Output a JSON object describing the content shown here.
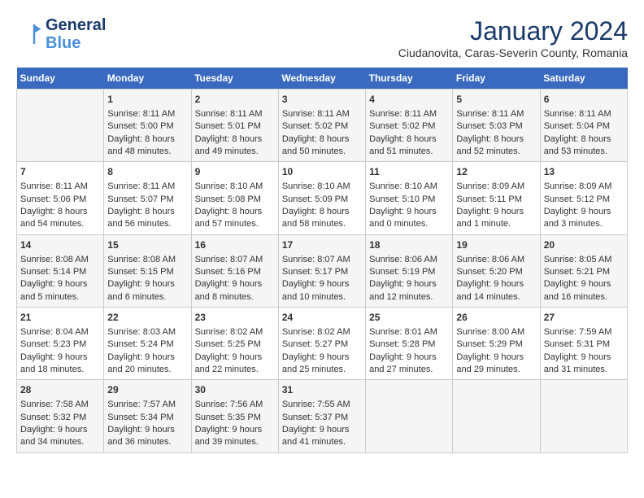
{
  "header": {
    "logo_line1": "General",
    "logo_line2": "Blue",
    "month": "January 2024",
    "location": "Ciudanovita, Caras-Severin County, Romania"
  },
  "days_of_week": [
    "Sunday",
    "Monday",
    "Tuesday",
    "Wednesday",
    "Thursday",
    "Friday",
    "Saturday"
  ],
  "weeks": [
    [
      {
        "day": "",
        "content": ""
      },
      {
        "day": "1",
        "content": "Sunrise: 8:11 AM\nSunset: 5:00 PM\nDaylight: 8 hours\nand 48 minutes."
      },
      {
        "day": "2",
        "content": "Sunrise: 8:11 AM\nSunset: 5:01 PM\nDaylight: 8 hours\nand 49 minutes."
      },
      {
        "day": "3",
        "content": "Sunrise: 8:11 AM\nSunset: 5:02 PM\nDaylight: 8 hours\nand 50 minutes."
      },
      {
        "day": "4",
        "content": "Sunrise: 8:11 AM\nSunset: 5:02 PM\nDaylight: 8 hours\nand 51 minutes."
      },
      {
        "day": "5",
        "content": "Sunrise: 8:11 AM\nSunset: 5:03 PM\nDaylight: 8 hours\nand 52 minutes."
      },
      {
        "day": "6",
        "content": "Sunrise: 8:11 AM\nSunset: 5:04 PM\nDaylight: 8 hours\nand 53 minutes."
      }
    ],
    [
      {
        "day": "7",
        "content": "Sunrise: 8:11 AM\nSunset: 5:06 PM\nDaylight: 8 hours\nand 54 minutes."
      },
      {
        "day": "8",
        "content": "Sunrise: 8:11 AM\nSunset: 5:07 PM\nDaylight: 8 hours\nand 56 minutes."
      },
      {
        "day": "9",
        "content": "Sunrise: 8:10 AM\nSunset: 5:08 PM\nDaylight: 8 hours\nand 57 minutes."
      },
      {
        "day": "10",
        "content": "Sunrise: 8:10 AM\nSunset: 5:09 PM\nDaylight: 8 hours\nand 58 minutes."
      },
      {
        "day": "11",
        "content": "Sunrise: 8:10 AM\nSunset: 5:10 PM\nDaylight: 9 hours\nand 0 minutes."
      },
      {
        "day": "12",
        "content": "Sunrise: 8:09 AM\nSunset: 5:11 PM\nDaylight: 9 hours\nand 1 minute."
      },
      {
        "day": "13",
        "content": "Sunrise: 8:09 AM\nSunset: 5:12 PM\nDaylight: 9 hours\nand 3 minutes."
      }
    ],
    [
      {
        "day": "14",
        "content": "Sunrise: 8:08 AM\nSunset: 5:14 PM\nDaylight: 9 hours\nand 5 minutes."
      },
      {
        "day": "15",
        "content": "Sunrise: 8:08 AM\nSunset: 5:15 PM\nDaylight: 9 hours\nand 6 minutes."
      },
      {
        "day": "16",
        "content": "Sunrise: 8:07 AM\nSunset: 5:16 PM\nDaylight: 9 hours\nand 8 minutes."
      },
      {
        "day": "17",
        "content": "Sunrise: 8:07 AM\nSunset: 5:17 PM\nDaylight: 9 hours\nand 10 minutes."
      },
      {
        "day": "18",
        "content": "Sunrise: 8:06 AM\nSunset: 5:19 PM\nDaylight: 9 hours\nand 12 minutes."
      },
      {
        "day": "19",
        "content": "Sunrise: 8:06 AM\nSunset: 5:20 PM\nDaylight: 9 hours\nand 14 minutes."
      },
      {
        "day": "20",
        "content": "Sunrise: 8:05 AM\nSunset: 5:21 PM\nDaylight: 9 hours\nand 16 minutes."
      }
    ],
    [
      {
        "day": "21",
        "content": "Sunrise: 8:04 AM\nSunset: 5:23 PM\nDaylight: 9 hours\nand 18 minutes."
      },
      {
        "day": "22",
        "content": "Sunrise: 8:03 AM\nSunset: 5:24 PM\nDaylight: 9 hours\nand 20 minutes."
      },
      {
        "day": "23",
        "content": "Sunrise: 8:02 AM\nSunset: 5:25 PM\nDaylight: 9 hours\nand 22 minutes."
      },
      {
        "day": "24",
        "content": "Sunrise: 8:02 AM\nSunset: 5:27 PM\nDaylight: 9 hours\nand 25 minutes."
      },
      {
        "day": "25",
        "content": "Sunrise: 8:01 AM\nSunset: 5:28 PM\nDaylight: 9 hours\nand 27 minutes."
      },
      {
        "day": "26",
        "content": "Sunrise: 8:00 AM\nSunset: 5:29 PM\nDaylight: 9 hours\nand 29 minutes."
      },
      {
        "day": "27",
        "content": "Sunrise: 7:59 AM\nSunset: 5:31 PM\nDaylight: 9 hours\nand 31 minutes."
      }
    ],
    [
      {
        "day": "28",
        "content": "Sunrise: 7:58 AM\nSunset: 5:32 PM\nDaylight: 9 hours\nand 34 minutes."
      },
      {
        "day": "29",
        "content": "Sunrise: 7:57 AM\nSunset: 5:34 PM\nDaylight: 9 hours\nand 36 minutes."
      },
      {
        "day": "30",
        "content": "Sunrise: 7:56 AM\nSunset: 5:35 PM\nDaylight: 9 hours\nand 39 minutes."
      },
      {
        "day": "31",
        "content": "Sunrise: 7:55 AM\nSunset: 5:37 PM\nDaylight: 9 hours\nand 41 minutes."
      },
      {
        "day": "",
        "content": ""
      },
      {
        "day": "",
        "content": ""
      },
      {
        "day": "",
        "content": ""
      }
    ]
  ]
}
